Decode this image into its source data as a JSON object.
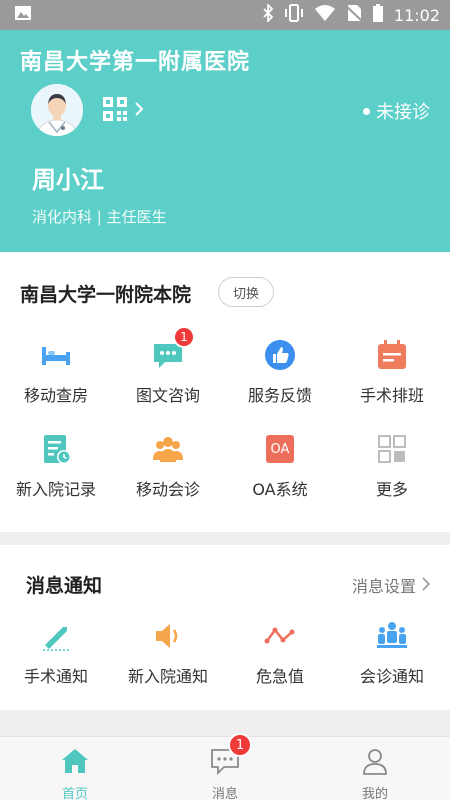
{
  "status_bar": {
    "time": "11:02"
  },
  "header": {
    "hospital_name": "南昌大学第一附属医院",
    "consult_status": "未接诊",
    "doctor_name": "周小江",
    "doctor_dept": "消化内科 | 主任医生"
  },
  "campus": {
    "name": "南昌大学一附院本院",
    "switch_label": "切换"
  },
  "features": [
    {
      "label": "移动查房",
      "icon": "bed-icon",
      "color": "#4aa3f0"
    },
    {
      "label": "图文咨询",
      "icon": "chat-icon",
      "color": "#4fc7bf",
      "badge": "1"
    },
    {
      "label": "服务反馈",
      "icon": "thumbs-up-icon",
      "color": "#3d8fef"
    },
    {
      "label": "手术排班",
      "icon": "calendar-icon",
      "color": "#f07c5e"
    },
    {
      "label": "新入院记录",
      "icon": "record-icon",
      "color": "#4fc7bf"
    },
    {
      "label": "移动会诊",
      "icon": "group-icon",
      "color": "#f5a54a"
    },
    {
      "label": "OA系统",
      "icon": "oa-icon",
      "color": "#ee6e5c",
      "icon_text": "OA"
    },
    {
      "label": "更多",
      "icon": "more-grid-icon",
      "color": "#bdbdbd"
    }
  ],
  "notices": {
    "title": "消息通知",
    "settings_label": "消息设置",
    "items": [
      {
        "label": "手术通知",
        "icon": "scalpel-icon",
        "color": "#4fc7bf"
      },
      {
        "label": "新入院通知",
        "icon": "speaker-icon",
        "color": "#f5a54a"
      },
      {
        "label": "危急值",
        "icon": "trend-icon",
        "color": "#ee6e5c"
      },
      {
        "label": "会诊通知",
        "icon": "meeting-icon",
        "color": "#4aa3f0"
      }
    ]
  },
  "tabbar": {
    "items": [
      {
        "label": "首页",
        "icon": "home-icon",
        "active": true
      },
      {
        "label": "消息",
        "icon": "message-icon",
        "badge": "1"
      },
      {
        "label": "我的",
        "icon": "person-icon"
      }
    ]
  },
  "colors": {
    "primary": "#5bcfc8",
    "badge": "#f03a3a"
  }
}
